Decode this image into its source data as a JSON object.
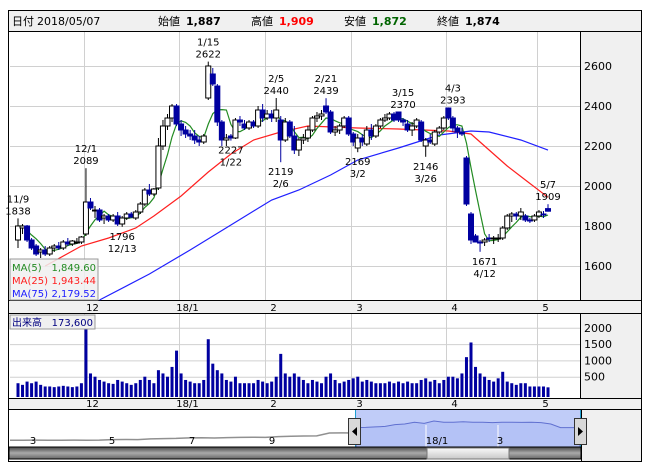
{
  "header": {
    "date_label": "日付",
    "date_value": "2018/05/07",
    "open_label": "始値",
    "open_value": "1,887",
    "high_label": "高値",
    "high_value": "1,909",
    "low_label": "安値",
    "low_value": "1,872",
    "close_label": "終値",
    "close_value": "1,874"
  },
  "legend": {
    "ma5_label": "MA(5)",
    "ma5_value": "1,849.60",
    "ma25_label": "MA(25)",
    "ma25_value": "1,943.44",
    "ma75_label": "MA(75)",
    "ma75_value": "2,179.52",
    "volume_label": "出来高",
    "volume_value": "173,600"
  },
  "colors": {
    "up_fill": "#ffffff",
    "down_fill": "#0000a0",
    "ma5": "#228b22",
    "ma25": "#ff2020",
    "ma75": "#2020ff",
    "volume": "#0000a0",
    "high": "#ff0000",
    "low": "#006400"
  },
  "navigator": {
    "labels": [
      "3",
      "5",
      "7",
      "9",
      "18/1",
      "3"
    ]
  },
  "chart_data": {
    "type": "candlestick",
    "title": "",
    "x_unit": "trading-day index (0 = 2017/11/09, 117 = 2018/05/07)",
    "price_axis": {
      "ticks": [
        "2600",
        "2400",
        "2200",
        "2000",
        "1800",
        "1600"
      ],
      "tick_values": [
        2600,
        2400,
        2200,
        2000,
        1800,
        1600
      ],
      "range": [
        1430,
        2745
      ]
    },
    "volume_axis": {
      "ticks": [
        "2000",
        "1500",
        "1000",
        "500"
      ],
      "tick_values": [
        2000,
        1500,
        1000,
        500
      ],
      "unit": "thousand shares"
    },
    "x_ticks": [
      {
        "label": "12",
        "index": 14.5
      },
      {
        "label": "18/1",
        "index": 35.5
      },
      {
        "label": "2",
        "index": 54.5
      },
      {
        "label": "3",
        "index": 73.5
      },
      {
        "label": "4",
        "index": 94.5
      },
      {
        "label": "5",
        "index": 114.5
      }
    ],
    "annotations": [
      {
        "index": 0,
        "date": "11/9",
        "value": "1838",
        "pos": "above",
        "price": 1838
      },
      {
        "index": 15,
        "date": "12/1",
        "value": "2089",
        "pos": "above",
        "price": 2089
      },
      {
        "index": 23,
        "date": "12/13",
        "value": "1796",
        "pos": "below",
        "price": 1796
      },
      {
        "index": 42,
        "date": "1/15",
        "value": "2622",
        "pos": "above",
        "price": 2622
      },
      {
        "index": 47,
        "date": "1/22",
        "value": "2227",
        "pos": "below",
        "price": 2227
      },
      {
        "index": 57,
        "date": "2/5",
        "value": "2440",
        "pos": "above",
        "price": 2440
      },
      {
        "index": 58,
        "date": "2/6",
        "value": "2119",
        "pos": "below",
        "price": 2119
      },
      {
        "index": 68,
        "date": "2/21",
        "value": "2439",
        "pos": "above",
        "price": 2439
      },
      {
        "index": 75,
        "date": "3/2",
        "value": "2169",
        "pos": "below",
        "price": 2169
      },
      {
        "index": 85,
        "date": "3/15",
        "value": "2370",
        "pos": "above",
        "price": 2370
      },
      {
        "index": 90,
        "date": "3/26",
        "value": "2146",
        "pos": "below",
        "price": 2146
      },
      {
        "index": 96,
        "date": "4/3",
        "value": "2393",
        "pos": "above",
        "price": 2393
      },
      {
        "index": 103,
        "date": "4/12",
        "value": "1671",
        "pos": "below",
        "price": 1671
      },
      {
        "index": 117,
        "date": "5/7",
        "value": "1909",
        "pos": "above",
        "price": 1909
      }
    ],
    "ohlcv": [
      [
        1730,
        1838,
        1690,
        1800,
        300
      ],
      [
        1790,
        1810,
        1760,
        1800,
        250
      ],
      [
        1800,
        1805,
        1720,
        1730,
        350
      ],
      [
        1730,
        1740,
        1680,
        1690,
        300
      ],
      [
        1700,
        1710,
        1650,
        1660,
        350
      ],
      [
        1670,
        1690,
        1640,
        1680,
        250
      ],
      [
        1680,
        1700,
        1650,
        1660,
        200
      ],
      [
        1660,
        1700,
        1650,
        1690,
        200
      ],
      [
        1690,
        1710,
        1670,
        1700,
        180
      ],
      [
        1700,
        1720,
        1680,
        1690,
        200
      ],
      [
        1690,
        1730,
        1680,
        1720,
        220
      ],
      [
        1720,
        1740,
        1700,
        1710,
        200
      ],
      [
        1710,
        1730,
        1700,
        1725,
        180
      ],
      [
        1720,
        1740,
        1710,
        1720,
        200
      ],
      [
        1720,
        1750,
        1710,
        1745,
        300
      ],
      [
        1760,
        2089,
        1750,
        1920,
        2100
      ],
      [
        1920,
        1940,
        1880,
        1890,
        600
      ],
      [
        1880,
        1900,
        1840,
        1880,
        500
      ],
      [
        1880,
        1890,
        1820,
        1830,
        400
      ],
      [
        1840,
        1860,
        1810,
        1850,
        350
      ],
      [
        1850,
        1860,
        1820,
        1830,
        300
      ],
      [
        1830,
        1860,
        1820,
        1850,
        280
      ],
      [
        1850,
        1870,
        1800,
        1810,
        400
      ],
      [
        1810,
        1850,
        1796,
        1840,
        350
      ],
      [
        1840,
        1870,
        1830,
        1860,
        300
      ],
      [
        1860,
        1870,
        1840,
        1845,
        250
      ],
      [
        1840,
        1880,
        1830,
        1870,
        300
      ],
      [
        1870,
        1920,
        1860,
        1910,
        400
      ],
      [
        1910,
        1990,
        1900,
        1980,
        500
      ],
      [
        1980,
        2010,
        1950,
        1960,
        400
      ],
      [
        1960,
        1990,
        1950,
        1985,
        300
      ],
      [
        1990,
        2240,
        1980,
        2200,
        700
      ],
      [
        2200,
        2330,
        2180,
        2300,
        600
      ],
      [
        2300,
        2360,
        2280,
        2340,
        500
      ],
      [
        2340,
        2410,
        2320,
        2400,
        800
      ],
      [
        2400,
        2410,
        2300,
        2310,
        1300
      ],
      [
        2310,
        2330,
        2250,
        2280,
        600
      ],
      [
        2280,
        2300,
        2240,
        2260,
        400
      ],
      [
        2260,
        2280,
        2230,
        2250,
        350
      ],
      [
        2250,
        2280,
        2210,
        2230,
        300
      ],
      [
        2230,
        2250,
        2200,
        2220,
        300
      ],
      [
        2220,
        2260,
        2210,
        2250,
        400
      ],
      [
        2440,
        2622,
        2430,
        2600,
        1650
      ],
      [
        2560,
        2590,
        2500,
        2510,
        900
      ],
      [
        2500,
        2510,
        2300,
        2320,
        700
      ],
      [
        2320,
        2330,
        2200,
        2230,
        600
      ],
      [
        2230,
        2260,
        2200,
        2240,
        400
      ],
      [
        2250,
        2260,
        2227,
        2240,
        350
      ],
      [
        2240,
        2340,
        2235,
        2330,
        500
      ],
      [
        2330,
        2350,
        2300,
        2320,
        300
      ],
      [
        2310,
        2330,
        2280,
        2290,
        300
      ],
      [
        2290,
        2330,
        2280,
        2320,
        300
      ],
      [
        2320,
        2330,
        2290,
        2300,
        300
      ],
      [
        2300,
        2400,
        2290,
        2380,
        400
      ],
      [
        2380,
        2410,
        2320,
        2340,
        350
      ],
      [
        2340,
        2380,
        2330,
        2360,
        300
      ],
      [
        2360,
        2380,
        2320,
        2340,
        350
      ],
      [
        2340,
        2440,
        2320,
        2380,
        500
      ],
      [
        2330,
        2350,
        2119,
        2230,
        1200
      ],
      [
        2230,
        2340,
        2220,
        2320,
        600
      ],
      [
        2320,
        2330,
        2240,
        2250,
        500
      ],
      [
        2250,
        2300,
        2160,
        2180,
        600
      ],
      [
        2180,
        2240,
        2150,
        2230,
        500
      ],
      [
        2230,
        2260,
        2210,
        2240,
        400
      ],
      [
        2240,
        2300,
        2220,
        2280,
        300
      ],
      [
        2280,
        2350,
        2270,
        2340,
        400
      ],
      [
        2340,
        2370,
        2320,
        2350,
        350
      ],
      [
        2350,
        2380,
        2330,
        2360,
        300
      ],
      [
        2400,
        2439,
        2360,
        2370,
        500
      ],
      [
        2370,
        2380,
        2260,
        2270,
        600
      ],
      [
        2270,
        2300,
        2250,
        2280,
        400
      ],
      [
        2280,
        2310,
        2260,
        2300,
        300
      ],
      [
        2300,
        2350,
        2290,
        2340,
        350
      ],
      [
        2340,
        2350,
        2250,
        2260,
        400
      ],
      [
        2260,
        2270,
        2200,
        2220,
        450
      ],
      [
        2190,
        2260,
        2169,
        2240,
        500
      ],
      [
        2240,
        2260,
        2200,
        2220,
        350
      ],
      [
        2210,
        2300,
        2200,
        2280,
        400
      ],
      [
        2280,
        2310,
        2230,
        2250,
        350
      ],
      [
        2250,
        2310,
        2240,
        2300,
        300
      ],
      [
        2300,
        2340,
        2290,
        2330,
        300
      ],
      [
        2330,
        2360,
        2320,
        2340,
        300
      ],
      [
        2340,
        2370,
        2330,
        2360,
        350
      ],
      [
        2360,
        2370,
        2320,
        2330,
        300
      ],
      [
        2370,
        2370,
        2320,
        2330,
        350
      ],
      [
        2330,
        2340,
        2300,
        2320,
        300
      ],
      [
        2310,
        2330,
        2270,
        2280,
        350
      ],
      [
        2280,
        2320,
        2250,
        2300,
        300
      ],
      [
        2300,
        2340,
        2290,
        2330,
        300
      ],
      [
        2320,
        2330,
        2220,
        2230,
        400
      ],
      [
        2200,
        2240,
        2146,
        2230,
        450
      ],
      [
        2230,
        2260,
        2210,
        2220,
        350
      ],
      [
        2210,
        2280,
        2200,
        2270,
        400
      ],
      [
        2270,
        2300,
        2260,
        2290,
        300
      ],
      [
        2290,
        2350,
        2280,
        2340,
        400
      ],
      [
        2390,
        2393,
        2330,
        2340,
        500
      ],
      [
        2340,
        2350,
        2270,
        2290,
        500
      ],
      [
        2290,
        2300,
        2240,
        2270,
        450
      ],
      [
        2270,
        2290,
        2250,
        2260,
        600
      ],
      [
        2140,
        2150,
        1900,
        1910,
        1100
      ],
      [
        1860,
        1870,
        1710,
        1730,
        1550
      ],
      [
        1750,
        1760,
        1720,
        1720,
        800
      ],
      [
        1720,
        1730,
        1671,
        1715,
        600
      ],
      [
        1720,
        1740,
        1700,
        1730,
        500
      ],
      [
        1740,
        1760,
        1720,
        1735,
        400
      ],
      [
        1735,
        1750,
        1710,
        1740,
        350
      ],
      [
        1740,
        1760,
        1720,
        1740,
        450
      ],
      [
        1740,
        1800,
        1730,
        1790,
        650
      ],
      [
        1790,
        1860,
        1780,
        1850,
        350
      ],
      [
        1850,
        1870,
        1820,
        1860,
        300
      ],
      [
        1860,
        1870,
        1830,
        1850,
        250
      ],
      [
        1850,
        1890,
        1830,
        1870,
        300
      ],
      [
        1850,
        1860,
        1820,
        1830,
        300
      ],
      [
        1830,
        1840,
        1815,
        1825,
        200
      ],
      [
        1830,
        1860,
        1820,
        1850,
        200
      ],
      [
        1850,
        1880,
        1840,
        1870,
        200
      ],
      [
        1860,
        1875,
        1840,
        1855,
        200
      ],
      [
        1887,
        1909,
        1872,
        1874,
        173.6
      ]
    ],
    "ma25": [
      [
        6,
        1600
      ],
      [
        14,
        1700
      ],
      [
        20,
        1740
      ],
      [
        26,
        1790
      ],
      [
        30,
        1850
      ],
      [
        36,
        1950
      ],
      [
        42,
        2070
      ],
      [
        47,
        2160
      ],
      [
        52,
        2230
      ],
      [
        58,
        2270
      ],
      [
        64,
        2300
      ],
      [
        75,
        2290
      ],
      [
        84,
        2285
      ],
      [
        95,
        2275
      ],
      [
        100,
        2260
      ],
      [
        104,
        2180
      ],
      [
        108,
        2100
      ],
      [
        112,
        2030
      ],
      [
        117,
        1943.44
      ]
    ],
    "ma75": [
      [
        18,
        1430
      ],
      [
        29,
        1560
      ],
      [
        38,
        1680
      ],
      [
        47,
        1805
      ],
      [
        56,
        1930
      ],
      [
        62,
        1980
      ],
      [
        69,
        2055
      ],
      [
        75,
        2130
      ],
      [
        84,
        2190
      ],
      [
        93,
        2255
      ],
      [
        100,
        2275
      ],
      [
        104,
        2270
      ],
      [
        111,
        2230
      ],
      [
        117,
        2179.52
      ]
    ],
    "navigator_history": [
      650,
      650,
      655,
      650,
      650,
      660,
      650,
      655,
      700,
      710,
      700,
      760,
      780,
      800,
      840,
      860,
      830,
      870,
      880,
      900,
      880,
      950,
      980,
      1000,
      1010,
      1250,
      1260,
      1250
    ],
    "navigator_selected": [
      1700,
      1720,
      1760,
      1800,
      1950,
      2000,
      2150,
      2050,
      2250,
      2150,
      2150,
      2180,
      2140,
      2150,
      2120,
      2150,
      2140,
      2130,
      2150,
      2120,
      2000,
      1700,
      1700,
      1710
    ]
  }
}
